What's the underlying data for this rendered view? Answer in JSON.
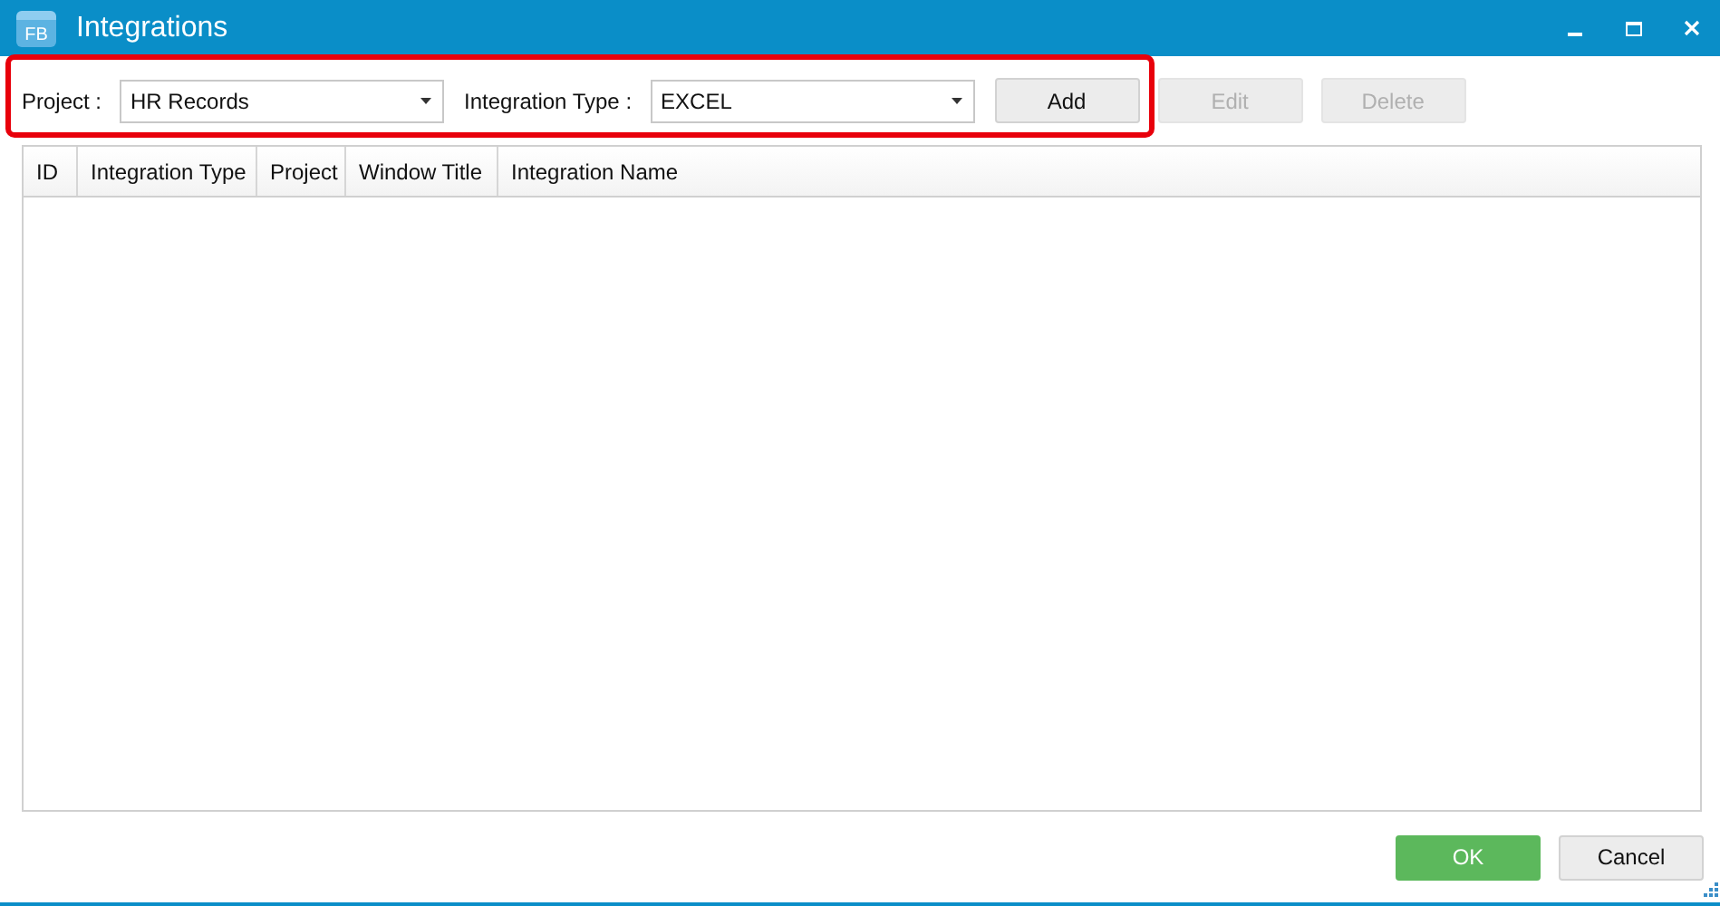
{
  "window": {
    "icon_text": "FB",
    "title": "Integrations"
  },
  "toolbar": {
    "project_label": "Project :",
    "project_value": "HR Records",
    "type_label": "Integration Type :",
    "type_value": "EXCEL",
    "buttons": [
      {
        "label": "Add",
        "disabled": false
      },
      {
        "label": "Edit",
        "disabled": true
      },
      {
        "label": "Delete",
        "disabled": true
      }
    ],
    "highlighted": true
  },
  "table": {
    "columns": [
      "ID",
      "Integration Type",
      "Project",
      "Window Title",
      "Integration Name"
    ]
  },
  "footer": {
    "buttons": [
      {
        "label": "OK",
        "kind": "primary"
      },
      {
        "label": "Cancel",
        "kind": "secondary"
      }
    ]
  }
}
